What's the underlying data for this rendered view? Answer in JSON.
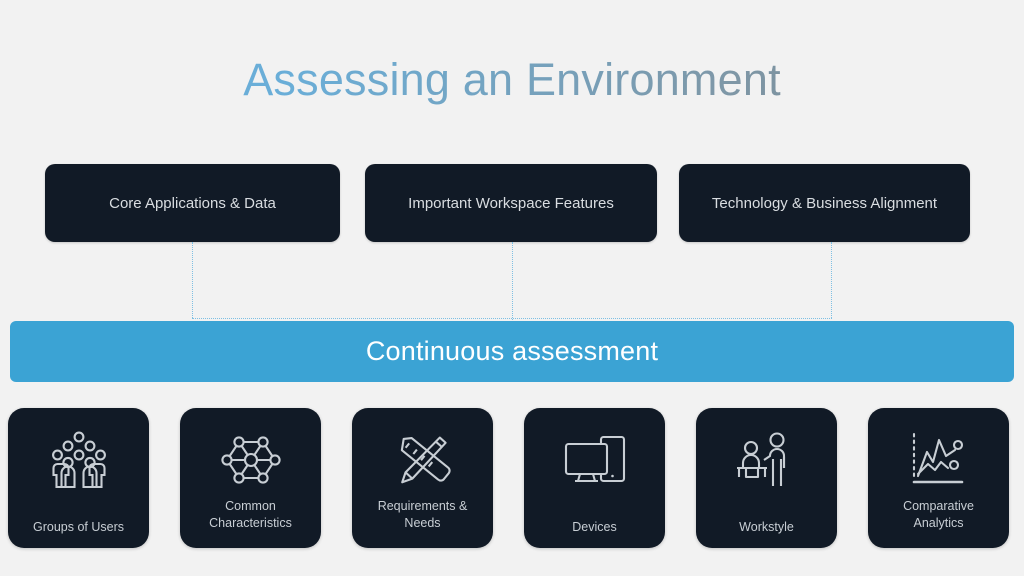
{
  "slide": {
    "title": "Assessing an Environment",
    "background_color": "#f2f2f2",
    "accent_color": "#3ba3d4",
    "dark_card_color": "#111a26",
    "connector_color": "#7fc0e3"
  },
  "top_boxes": [
    {
      "label": "Core Applications & Data"
    },
    {
      "label": "Important Workspace Features"
    },
    {
      "label": "Technology & Business Alignment"
    }
  ],
  "middle_bar": {
    "label": "Continuous assessment"
  },
  "bottom_cards": [
    {
      "label": "Groups of Users",
      "icon": "group-of-users-icon",
      "lines": 1
    },
    {
      "label": "Common\nCharacteristics",
      "icon": "network-nodes-icon",
      "lines": 2
    },
    {
      "label": "Requirements &\nNeeds",
      "icon": "pencil-ruler-icon",
      "lines": 2
    },
    {
      "label": "Devices",
      "icon": "monitor-tablet-icon",
      "lines": 1
    },
    {
      "label": "Workstyle",
      "icon": "people-at-desk-icon",
      "lines": 1
    },
    {
      "label": "Comparative\nAnalytics",
      "icon": "line-chart-icon",
      "lines": 2
    }
  ]
}
